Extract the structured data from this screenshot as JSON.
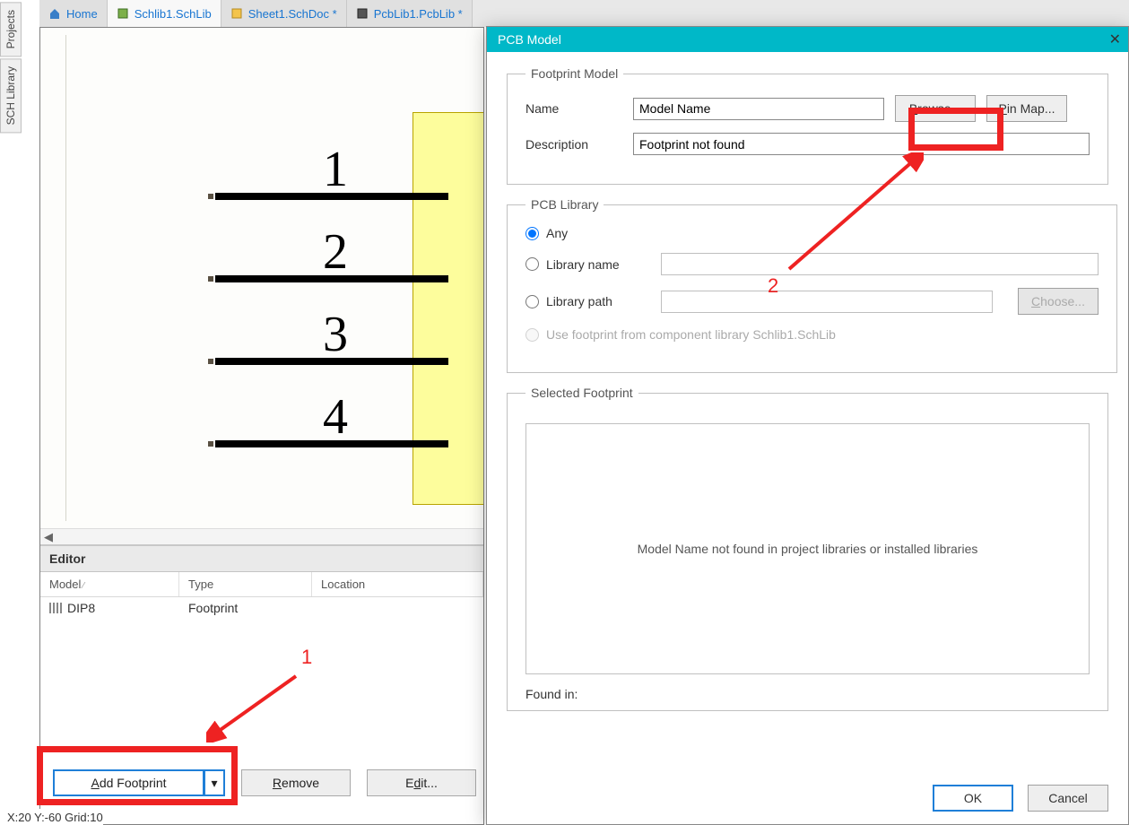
{
  "side_tabs": {
    "projects": "Projects",
    "schlib": "SCH Library"
  },
  "doc_tabs": {
    "home": "Home",
    "schlib": "Schlib1.SchLib",
    "sheet": "Sheet1.SchDoc *",
    "pcblib": "PcbLib1.PcbLib *"
  },
  "schematic": {
    "pins": [
      "1",
      "2",
      "3",
      "4"
    ]
  },
  "editor": {
    "tab": "Editor",
    "cols": {
      "model": "Model",
      "type": "Type",
      "location": "Location"
    },
    "row": {
      "model": "DIP8",
      "type": "Footprint",
      "location": ""
    }
  },
  "buttons": {
    "add": "Add Footprint",
    "remove": "Remove",
    "edit": "Edit..."
  },
  "annotations": {
    "n1": "1",
    "n2": "2"
  },
  "status": "X:20 Y:-60  Grid:10",
  "dialog": {
    "title": "PCB Model",
    "footprint_group": "Footprint Model",
    "name_label": "Name",
    "name_value": "Model Name",
    "browse": "Browse...",
    "pinmap": "Pin Map...",
    "desc_label": "Description",
    "desc_value": "Footprint not found",
    "pcb_group": "PCB Library",
    "any": "Any",
    "libname": "Library name",
    "libpath": "Library path",
    "choose": "Choose...",
    "use_from": "Use footprint from component library Schlib1.SchLib",
    "sel_group": "Selected Footprint",
    "notfound": "Model Name not found in project libraries or installed libraries",
    "foundin": "Found in:",
    "ok": "OK",
    "cancel": "Cancel"
  }
}
